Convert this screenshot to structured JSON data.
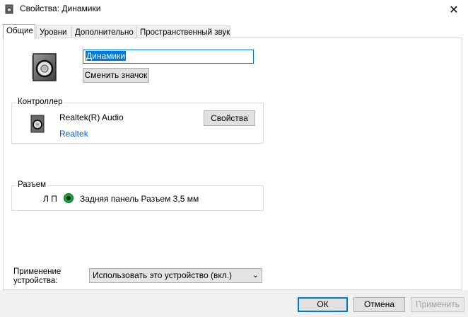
{
  "window": {
    "title": "Свойства: Динамики",
    "close_glyph": "✕"
  },
  "tabs": [
    {
      "label": "Общие",
      "active": true
    },
    {
      "label": "Уровни"
    },
    {
      "label": "Дополнительно"
    },
    {
      "label": "Пространственный звук"
    }
  ],
  "device": {
    "name_value": "Динамики",
    "change_icon_label": "Сменить значок",
    "icon": "speaker-icon"
  },
  "controller": {
    "group_label": "Контроллер",
    "name": "Realtek(R) Audio",
    "vendor_link": "Realtek",
    "properties_label": "Свойства",
    "icon": "speaker-icon"
  },
  "jack": {
    "group_label": "Разъем",
    "channels": "Л П",
    "description": "Задняя панель Разъем 3,5 мм",
    "color": "#17a43a"
  },
  "usage": {
    "label_line1": "Применение",
    "label_line2": "устройства:",
    "selected": "Использовать это устройство (вкл.)"
  },
  "buttons": {
    "ok": "ОК",
    "cancel": "Отмена",
    "apply": "Применить"
  }
}
